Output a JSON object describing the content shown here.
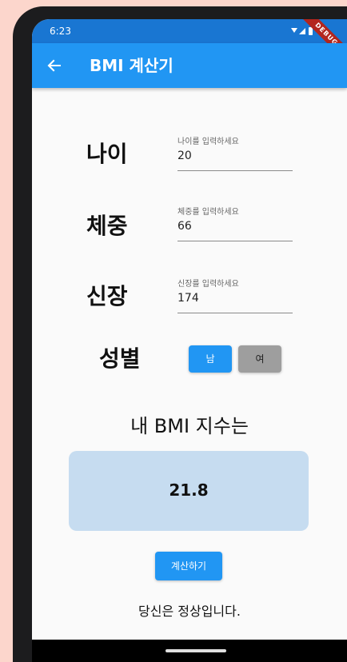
{
  "status_bar": {
    "time": "6:23",
    "debug_label": "DEBUG"
  },
  "app_bar": {
    "title": "BMI 계산기",
    "back_icon": "arrow-back-icon",
    "color": "#2196f3"
  },
  "form": {
    "age": {
      "label": "나이",
      "hint": "나이를 입력하세요",
      "value": "20"
    },
    "weight": {
      "label": "체중",
      "hint": "체중를 입력하세요",
      "value": "66"
    },
    "height": {
      "label": "신장",
      "hint": "신장를 입력하세요",
      "value": "174"
    },
    "gender": {
      "label": "성별",
      "male": "남",
      "female": "여",
      "selected": "남"
    }
  },
  "result": {
    "heading": "내 BMI 지수는",
    "bmi_value": "21.8",
    "calculate_label": "계산하기",
    "message": "당신은 정상입니다."
  },
  "colors": {
    "primary": "#2196f3",
    "bmi_box": "#c6dcf0",
    "unselected": "#9e9e9e",
    "background": "#fcd6cc"
  }
}
